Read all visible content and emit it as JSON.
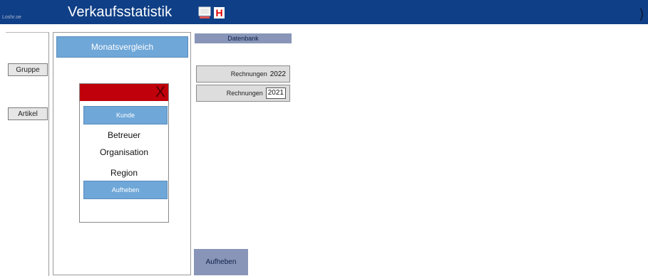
{
  "titlebar": {
    "small_label": "Loshr.oe",
    "title": "Verkaufsstatistik",
    "icons": [
      "monitor-icon",
      "h-icon"
    ],
    "h_label": "H",
    "close_glyph": ")"
  },
  "sidebar": {
    "group_label": "Gruppe",
    "article_label": "Artikel"
  },
  "main": {
    "month_compare_label": "Monatsvergleich"
  },
  "dialog": {
    "close_label": "X",
    "customer_label": "Kunde",
    "supervisor_label": "Betreuer",
    "organisation_label": "Organisation",
    "region_label": "Region",
    "cancel_label": "Aufheben"
  },
  "database": {
    "title": "Datenbank",
    "invoices_2022_label": "Rechnungen",
    "invoices_2022_year": "2022",
    "invoices_2021_label": "Rechnungen",
    "invoices_2021_year": "2021",
    "cancel_label": "Aufheben"
  },
  "colors": {
    "titlebar": "#0f3f86",
    "button_blue": "#6fa7d8",
    "dialog_header_red": "#c0000a",
    "slate_label": "#8895b8",
    "gray_button": "#dddddd"
  }
}
